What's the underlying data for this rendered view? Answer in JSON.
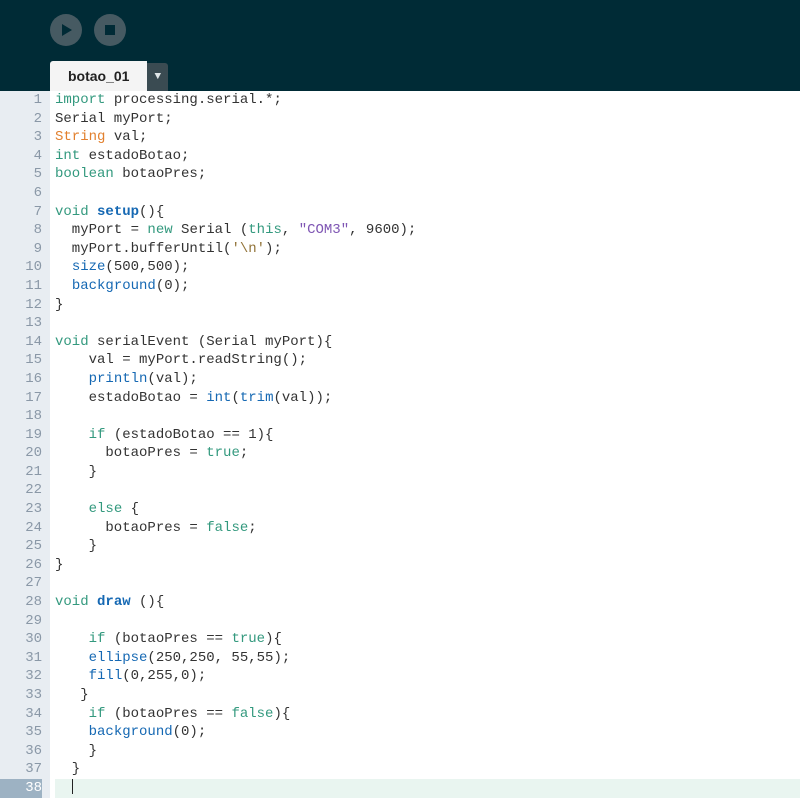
{
  "toolbar": {
    "run_label": "Run",
    "stop_label": "Stop"
  },
  "tab": {
    "name": "botao_01",
    "dropdown_glyph": "▼"
  },
  "editor": {
    "line_count": 38,
    "current_line": 38,
    "lines": [
      {
        "n": 1,
        "tokens": [
          [
            "kw",
            "import"
          ],
          [
            "",
            " processing.serial.*;"
          ]
        ]
      },
      {
        "n": 2,
        "tokens": [
          [
            "",
            "Serial myPort;"
          ]
        ]
      },
      {
        "n": 3,
        "tokens": [
          [
            "type",
            "String"
          ],
          [
            "",
            " val;"
          ]
        ]
      },
      {
        "n": 4,
        "tokens": [
          [
            "kw",
            "int"
          ],
          [
            "",
            " estadoBotao;"
          ]
        ]
      },
      {
        "n": 5,
        "tokens": [
          [
            "kw",
            "boolean"
          ],
          [
            "",
            " botaoPres;"
          ]
        ]
      },
      {
        "n": 6,
        "tokens": []
      },
      {
        "n": 7,
        "tokens": [
          [
            "kw",
            "void"
          ],
          [
            "",
            " "
          ],
          [
            "fnDecl",
            "setup"
          ],
          [
            "",
            "(){"
          ]
        ]
      },
      {
        "n": 8,
        "tokens": [
          [
            "",
            "  myPort = "
          ],
          [
            "kw",
            "new"
          ],
          [
            "",
            " Serial ("
          ],
          [
            "kw",
            "this"
          ],
          [
            "",
            ", "
          ],
          [
            "str",
            "\"COM3\""
          ],
          [
            "",
            ", 9600);"
          ]
        ]
      },
      {
        "n": 9,
        "tokens": [
          [
            "",
            "  myPort.bufferUntil("
          ],
          [
            "chr",
            "'\\n'"
          ],
          [
            "",
            ");"
          ]
        ]
      },
      {
        "n": 10,
        "tokens": [
          [
            "",
            "  "
          ],
          [
            "fnCall",
            "size"
          ],
          [
            "",
            "(500,500);"
          ]
        ]
      },
      {
        "n": 11,
        "tokens": [
          [
            "",
            "  "
          ],
          [
            "fnCall",
            "background"
          ],
          [
            "",
            "(0);"
          ]
        ]
      },
      {
        "n": 12,
        "tokens": [
          [
            "",
            "}"
          ]
        ]
      },
      {
        "n": 13,
        "tokens": []
      },
      {
        "n": 14,
        "tokens": [
          [
            "kw",
            "void"
          ],
          [
            "",
            " serialEvent (Serial myPort){"
          ]
        ]
      },
      {
        "n": 15,
        "tokens": [
          [
            "",
            "    val = myPort.readString();"
          ]
        ]
      },
      {
        "n": 16,
        "tokens": [
          [
            "",
            "    "
          ],
          [
            "fnCall",
            "println"
          ],
          [
            "",
            "(val);"
          ]
        ]
      },
      {
        "n": 17,
        "tokens": [
          [
            "",
            "    estadoBotao = "
          ],
          [
            "fnCall",
            "int"
          ],
          [
            "",
            "("
          ],
          [
            "fnCall",
            "trim"
          ],
          [
            "",
            "(val));"
          ]
        ]
      },
      {
        "n": 18,
        "tokens": []
      },
      {
        "n": 19,
        "tokens": [
          [
            "",
            "    "
          ],
          [
            "kw",
            "if"
          ],
          [
            "",
            " (estadoBotao == 1){"
          ]
        ]
      },
      {
        "n": 20,
        "tokens": [
          [
            "",
            "      botaoPres = "
          ],
          [
            "kw",
            "true"
          ],
          [
            "",
            ";"
          ]
        ]
      },
      {
        "n": 21,
        "tokens": [
          [
            "",
            "    }"
          ]
        ]
      },
      {
        "n": 22,
        "tokens": []
      },
      {
        "n": 23,
        "tokens": [
          [
            "",
            "    "
          ],
          [
            "kw",
            "else"
          ],
          [
            "",
            " {"
          ]
        ]
      },
      {
        "n": 24,
        "tokens": [
          [
            "",
            "      botaoPres = "
          ],
          [
            "kw",
            "false"
          ],
          [
            "",
            ";"
          ]
        ]
      },
      {
        "n": 25,
        "tokens": [
          [
            "",
            "    }"
          ]
        ]
      },
      {
        "n": 26,
        "tokens": [
          [
            "",
            "}"
          ]
        ]
      },
      {
        "n": 27,
        "tokens": []
      },
      {
        "n": 28,
        "tokens": [
          [
            "kw",
            "void"
          ],
          [
            "",
            " "
          ],
          [
            "fnDecl",
            "draw"
          ],
          [
            "",
            " (){"
          ]
        ]
      },
      {
        "n": 29,
        "tokens": []
      },
      {
        "n": 30,
        "tokens": [
          [
            "",
            "    "
          ],
          [
            "kw",
            "if"
          ],
          [
            "",
            " (botaoPres == "
          ],
          [
            "kw",
            "true"
          ],
          [
            "",
            "){"
          ]
        ]
      },
      {
        "n": 31,
        "tokens": [
          [
            "",
            "    "
          ],
          [
            "fnCall",
            "ellipse"
          ],
          [
            "",
            "(250,250, 55,55);"
          ]
        ]
      },
      {
        "n": 32,
        "tokens": [
          [
            "",
            "    "
          ],
          [
            "fnCall",
            "fill"
          ],
          [
            "",
            "(0,255,0);"
          ]
        ]
      },
      {
        "n": 33,
        "tokens": [
          [
            "",
            "   }"
          ]
        ]
      },
      {
        "n": 34,
        "tokens": [
          [
            "",
            "    "
          ],
          [
            "kw",
            "if"
          ],
          [
            "",
            " (botaoPres == "
          ],
          [
            "kw",
            "false"
          ],
          [
            "",
            "){"
          ]
        ]
      },
      {
        "n": 35,
        "tokens": [
          [
            "",
            "    "
          ],
          [
            "fnCall",
            "background"
          ],
          [
            "",
            "(0);"
          ]
        ]
      },
      {
        "n": 36,
        "tokens": [
          [
            "",
            "    }"
          ]
        ]
      },
      {
        "n": 37,
        "tokens": [
          [
            "",
            "  }"
          ]
        ]
      },
      {
        "n": 38,
        "tokens": [
          [
            "",
            "  "
          ]
        ],
        "cursor": true
      }
    ]
  }
}
